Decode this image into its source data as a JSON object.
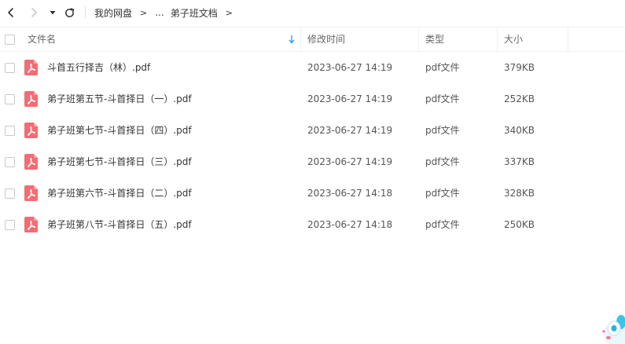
{
  "toolbar": {
    "back_icon": "chevron-left-icon",
    "forward_icon": "chevron-right-icon",
    "history_icon": "caret-down-icon",
    "refresh_icon": "refresh-icon",
    "breadcrumb": {
      "root": "我的网盘",
      "sep1": ">",
      "ellipsis": "...",
      "current": "弟子班文档",
      "sep2": ">",
      "sep3": ">"
    }
  },
  "columns": {
    "name": "文件名",
    "modified": "修改时间",
    "type": "类型",
    "size": "大小",
    "sort_icon": "sort-down-arrow-icon"
  },
  "files": [
    {
      "name": "斗首五行择吉（林）.pdf",
      "modified": "2023-06-27 14:19",
      "type": "pdf文件",
      "size": "379KB",
      "icon": "pdf-icon"
    },
    {
      "name": "弟子班第五节-斗首择日（一）.pdf",
      "modified": "2023-06-27 14:19",
      "type": "pdf文件",
      "size": "252KB",
      "icon": "pdf-icon"
    },
    {
      "name": "弟子班第七节-斗首择日（四）.pdf",
      "modified": "2023-06-27 14:19",
      "type": "pdf文件",
      "size": "340KB",
      "icon": "pdf-icon"
    },
    {
      "name": "弟子班第七节-斗首择日（三）.pdf",
      "modified": "2023-06-27 14:19",
      "type": "pdf文件",
      "size": "337KB",
      "icon": "pdf-icon"
    },
    {
      "name": "弟子班第六节-斗首择日（二）.pdf",
      "modified": "2023-06-27 14:18",
      "type": "pdf文件",
      "size": "328KB",
      "icon": "pdf-icon"
    },
    {
      "name": "弟子班第八节-斗首择日（五）.pdf",
      "modified": "2023-06-27 14:18",
      "type": "pdf文件",
      "size": "250KB",
      "icon": "pdf-icon"
    }
  ],
  "colors": {
    "pdf_icon": "#f56b73",
    "sort_arrow": "#2ea2f5",
    "text_primary": "#333333",
    "text_secondary": "#666666"
  }
}
